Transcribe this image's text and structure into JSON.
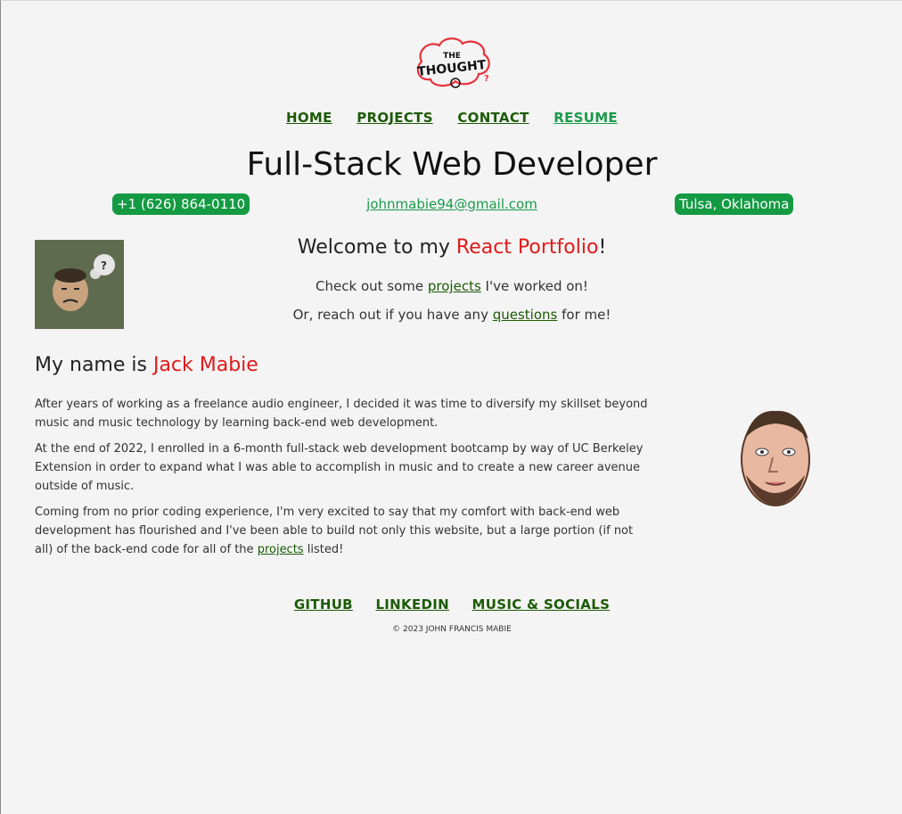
{
  "nav": {
    "home": "HOME",
    "projects": "PROJECTS",
    "contact": "CONTACT",
    "resume": "RESUME"
  },
  "header": {
    "title": "Full-Stack Web Developer",
    "phone": "+1 (626) 864-0110",
    "email": "johnmabie94@gmail.com",
    "location": "Tulsa, Oklahoma"
  },
  "welcome": {
    "prefix": "Welcome to my ",
    "highlight": "React Portfolio",
    "suffix": "!",
    "line1_prefix": "Check out some ",
    "line1_link": "projects",
    "line1_suffix": " I've worked on!",
    "line2_prefix": "Or, reach out if you have any ",
    "line2_link": "questions",
    "line2_suffix": " for me!"
  },
  "about": {
    "heading_prefix": "My name is ",
    "heading_name": "Jack Mabie",
    "p1": "After years of working as a freelance audio engineer, I decided it was time to diversify my skillset beyond music and music technology by learning back-end web development.",
    "p2": "At the end of 2022, I enrolled in a 6-month full-stack web development bootcamp by way of UC Berkeley Extension in order to expand what I was able to accomplish in music and to create a new career avenue outside of music.",
    "p3_prefix": "Coming from no prior coding experience, I'm very excited to say that my comfort with back-end web development has flourished and I've been able to build not only this website, but a large portion (if not all) of the back-end code for all of the ",
    "p3_link": "projects",
    "p3_suffix": " listed!"
  },
  "footer": {
    "github": "GITHUB",
    "linkedin": "LINKEDIN",
    "music": "MUSIC & SOCIALS",
    "copyright": "© 2023 JOHN FRANCIS MABIE"
  },
  "logo_text": "THE THOUGHT",
  "colors": {
    "accent_green": "#139a42",
    "link_green": "#1c5a06",
    "highlight_red": "#e01919",
    "background": "#f4f4f4"
  }
}
